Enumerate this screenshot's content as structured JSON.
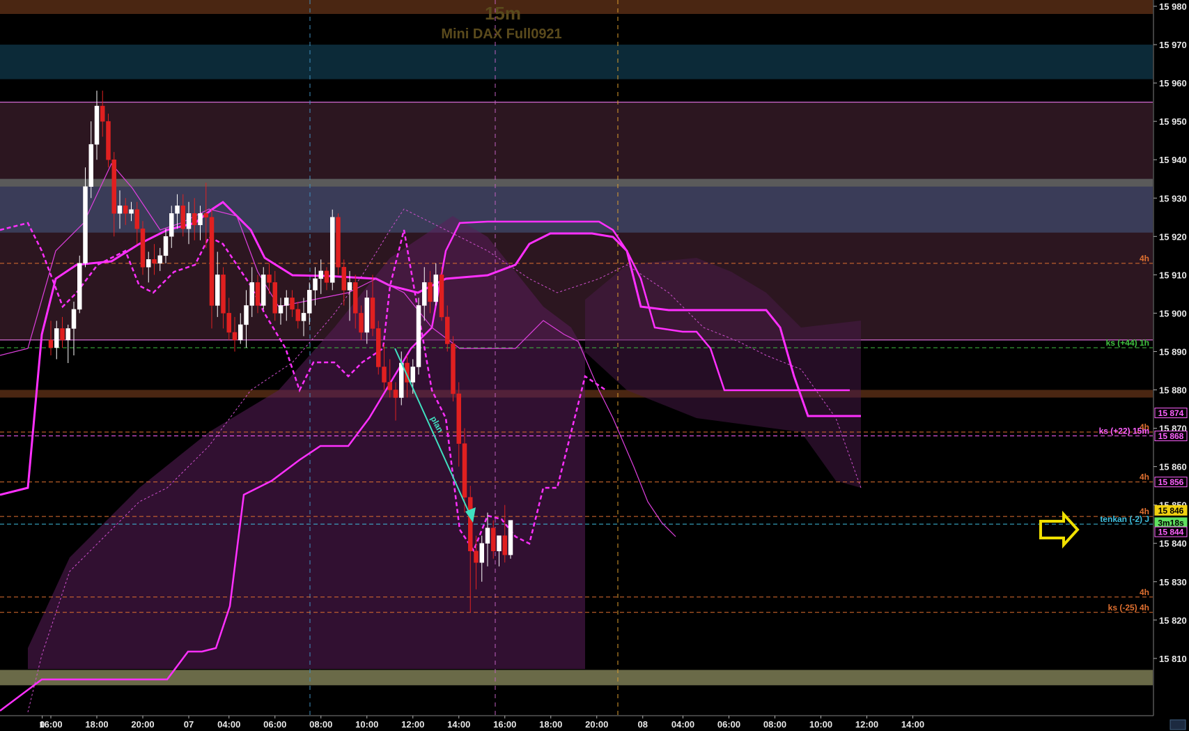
{
  "chart_title": "15m",
  "instrument": "Mini DAX Full0921",
  "colors": {
    "background": "#000000",
    "bull_candle": "#ffffff",
    "bear_candle": "#e02020",
    "cloud": "#c040c0",
    "kijun": "#ff30ff",
    "axis_text": "#e8e8e8",
    "level_4h": "#e07030",
    "level_1h": "#40c040",
    "level_15m": "#ff60ff",
    "tenkan": "#40c0e0",
    "current_price": "#f0d010",
    "plan_arrow": "#40e0c0",
    "right_arrow": "#f0e000"
  },
  "chart_data": {
    "type": "candlestick",
    "title": "15m",
    "subtitle": "Mini DAX Full0921",
    "ylim": [
      15808,
      15982
    ],
    "yticks": [
      "15 980",
      "15 970",
      "15 960",
      "15 950",
      "15 940",
      "15 930",
      "15 920",
      "15 910",
      "15 900",
      "15 890",
      "15 880",
      "15 870",
      "15 860",
      "15 850",
      "15 840",
      "15 830",
      "15 820",
      "15 810"
    ],
    "ytick_values": [
      15980,
      15970,
      15960,
      15950,
      15940,
      15930,
      15920,
      15910,
      15900,
      15890,
      15880,
      15870,
      15860,
      15850,
      15840,
      15830,
      15820,
      15810
    ],
    "xticks": [
      "0",
      "16:00",
      "18:00",
      "20:00",
      "07",
      "04:00",
      "06:00",
      "08:00",
      "10:00",
      "12:00",
      "14:00",
      "16:00",
      "18:00",
      "20:00",
      "08",
      "04:00",
      "06:00",
      "08:00",
      "10:00",
      "12:00",
      "14:00"
    ],
    "xtick_bar": [
      -1.5,
      0,
      8,
      16,
      24,
      31,
      39,
      47,
      55,
      63,
      71,
      79,
      87,
      95,
      103,
      110,
      118,
      126,
      134,
      142,
      150
    ],
    "candles": [
      [
        15893,
        15898,
        15889,
        15891
      ],
      [
        15891,
        15898,
        15888,
        15896
      ],
      [
        15896,
        15899,
        15891,
        15893
      ],
      [
        15893,
        15897,
        15887,
        15896
      ],
      [
        15896,
        15903,
        15889,
        15901
      ],
      [
        15901,
        15915,
        15900,
        15913
      ],
      [
        15913,
        15938,
        15912,
        15933
      ],
      [
        15933,
        15950,
        15930,
        15944
      ],
      [
        15944,
        15958,
        15940,
        15954
      ],
      [
        15954,
        15958,
        15946,
        15950
      ],
      [
        15950,
        15952,
        15938,
        15940
      ],
      [
        15940,
        15942,
        15920,
        15926
      ],
      [
        15926,
        15932,
        15922,
        15928
      ],
      [
        15928,
        15930,
        15923,
        15926
      ],
      [
        15926,
        15929,
        15924,
        15927
      ],
      [
        15927,
        15929,
        15918,
        15922
      ],
      [
        15922,
        15924,
        15910,
        15912
      ],
      [
        15912,
        15916,
        15908,
        15914
      ],
      [
        15914,
        15918,
        15910,
        15913
      ],
      [
        15913,
        15917,
        15911,
        15915
      ],
      [
        15915,
        15922,
        15913,
        15920
      ],
      [
        15920,
        15928,
        15917,
        15926
      ],
      [
        15926,
        15931,
        15922,
        15928
      ],
      [
        15928,
        15931,
        15920,
        15922
      ],
      [
        15922,
        15929,
        15918,
        15926
      ],
      [
        15926,
        15930,
        15919,
        15923
      ],
      [
        15923,
        15928,
        15919,
        15926
      ],
      [
        15926,
        15934,
        15917,
        15925
      ],
      [
        15925,
        15927,
        15896,
        15902
      ],
      [
        15902,
        15916,
        15899,
        15910
      ],
      [
        15910,
        15912,
        15896,
        15900
      ],
      [
        15900,
        15904,
        15893,
        15895
      ],
      [
        15895,
        15899,
        15890,
        15893
      ],
      [
        15893,
        15900,
        15892,
        15897
      ],
      [
        15897,
        15906,
        15891,
        15902
      ],
      [
        15902,
        15912,
        15899,
        15908
      ],
      [
        15908,
        15910,
        15900,
        15902
      ],
      [
        15902,
        15912,
        15901,
        15910
      ],
      [
        15910,
        15913,
        15905,
        15908
      ],
      [
        15908,
        15911,
        15898,
        15900
      ],
      [
        15900,
        15904,
        15897,
        15902
      ],
      [
        15902,
        15906,
        15898,
        15904
      ],
      [
        15904,
        15906,
        15899,
        15901
      ],
      [
        15901,
        15903,
        15896,
        15898
      ],
      [
        15898,
        15904,
        15894,
        15900
      ],
      [
        15900,
        15908,
        15897,
        15906
      ],
      [
        15906,
        15912,
        15902,
        15909
      ],
      [
        15909,
        15914,
        15905,
        15911
      ],
      [
        15911,
        15912,
        15906,
        15908
      ],
      [
        15908,
        15927,
        15906,
        15925
      ],
      [
        15925,
        15926,
        15910,
        15912
      ],
      [
        15912,
        15914,
        15902,
        15906
      ],
      [
        15906,
        15911,
        15898,
        15908
      ],
      [
        15908,
        15910,
        15896,
        15900
      ],
      [
        15900,
        15902,
        15893,
        15895
      ],
      [
        15895,
        15906,
        15892,
        15904
      ],
      [
        15904,
        15910,
        15894,
        15896
      ],
      [
        15896,
        15898,
        15884,
        15886
      ],
      [
        15886,
        15892,
        15880,
        15882
      ],
      [
        15882,
        15888,
        15878,
        15880
      ],
      [
        15880,
        15882,
        15872,
        15878
      ],
      [
        15878,
        15890,
        15876,
        15887
      ],
      [
        15887,
        15889,
        15878,
        15882
      ],
      [
        15882,
        15888,
        15879,
        15886
      ],
      [
        15886,
        15904,
        15884,
        15902
      ],
      [
        15902,
        15912,
        15898,
        15908
      ],
      [
        15908,
        15911,
        15900,
        15903
      ],
      [
        15903,
        15913,
        15902,
        15910
      ],
      [
        15910,
        15912,
        15898,
        15899
      ],
      [
        15899,
        15902,
        15890,
        15892
      ],
      [
        15892,
        15894,
        15877,
        15879
      ],
      [
        15879,
        15882,
        15860,
        15866
      ],
      [
        15866,
        15870,
        15848,
        15852
      ],
      [
        15852,
        15855,
        15822,
        15838
      ],
      [
        15838,
        15842,
        15828,
        15835
      ],
      [
        15835,
        15842,
        15830,
        15840
      ],
      [
        15840,
        15848,
        15834,
        15844
      ],
      [
        15844,
        15846,
        15836,
        15838
      ],
      [
        15838,
        15840,
        15834,
        15842
      ],
      [
        15842,
        15850,
        15835,
        15837
      ],
      [
        15837,
        15846,
        15836,
        15846
      ]
    ],
    "horizontal_levels": [
      {
        "price": 15913,
        "label": "4h"
      },
      {
        "price": 15891,
        "label": "ks (+44) 1h"
      },
      {
        "price": 15869,
        "label": "4h"
      },
      {
        "price": 15868,
        "label": "ks (+22) 15m"
      },
      {
        "price": 15856,
        "label": "4h"
      },
      {
        "price": 15847,
        "label": "4h"
      },
      {
        "price": 15845,
        "label": "tenkan (-2) J"
      },
      {
        "price": 15826,
        "label": "4h"
      },
      {
        "price": 15822,
        "label": "ks (-25) 4h"
      }
    ],
    "price_tags": [
      "15 874",
      "15 868",
      "15 856",
      "15 846",
      "3m18s",
      "15 844"
    ],
    "annotations": [
      "plan"
    ],
    "grid": false,
    "legend": "none"
  }
}
